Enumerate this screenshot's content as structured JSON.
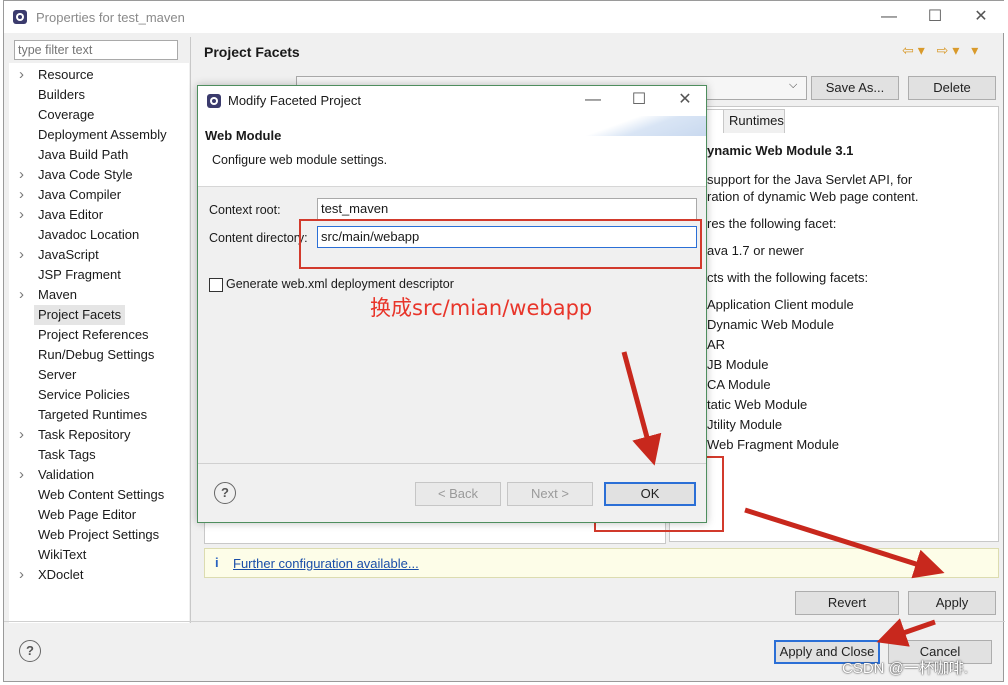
{
  "window": {
    "title": "Properties for test_maven",
    "filter_placeholder": "type filter text"
  },
  "tree": {
    "items": [
      {
        "label": "Resource",
        "expandable": true
      },
      {
        "label": "Builders",
        "expandable": false
      },
      {
        "label": "Coverage",
        "expandable": false
      },
      {
        "label": "Deployment Assembly",
        "expandable": false
      },
      {
        "label": "Java Build Path",
        "expandable": false
      },
      {
        "label": "Java Code Style",
        "expandable": true
      },
      {
        "label": "Java Compiler",
        "expandable": true
      },
      {
        "label": "Java Editor",
        "expandable": true
      },
      {
        "label": "Javadoc Location",
        "expandable": false
      },
      {
        "label": "JavaScript",
        "expandable": true
      },
      {
        "label": "JSP Fragment",
        "expandable": false
      },
      {
        "label": "Maven",
        "expandable": true
      },
      {
        "label": "Project Facets",
        "expandable": false,
        "selected": true
      },
      {
        "label": "Project References",
        "expandable": false
      },
      {
        "label": "Run/Debug Settings",
        "expandable": false
      },
      {
        "label": "Server",
        "expandable": false
      },
      {
        "label": "Service Policies",
        "expandable": false
      },
      {
        "label": "Targeted Runtimes",
        "expandable": false
      },
      {
        "label": "Task Repository",
        "expandable": true
      },
      {
        "label": "Task Tags",
        "expandable": false
      },
      {
        "label": "Validation",
        "expandable": true
      },
      {
        "label": "Web Content Settings",
        "expandable": false
      },
      {
        "label": "Web Page Editor",
        "expandable": false
      },
      {
        "label": "Web Project Settings",
        "expandable": false
      },
      {
        "label": "WikiText",
        "expandable": false
      },
      {
        "label": "XDoclet",
        "expandable": true
      }
    ]
  },
  "right_panel": {
    "title": "Project Facets",
    "save_as_label": "Save As...",
    "delete_label": "Delete",
    "tab_details_fragment": "ls",
    "tab_runtimes": "Runtimes",
    "details_lines": [
      "ynamic Web Module 3.1",
      "support for the Java Servlet API, for",
      "ration of dynamic Web page content.",
      "res the following facet:",
      "ava 1.7 or newer",
      "cts with the following facets:",
      "Application Client module",
      "Dynamic Web Module",
      "AR",
      "JB Module",
      "CA Module",
      "tatic Web Module",
      "Jtility Module",
      "Web Fragment Module"
    ],
    "info_icon_glyph": "i",
    "info_link": "Further configuration available...",
    "revert_label": "Revert",
    "apply_label": "Apply"
  },
  "footer": {
    "apply_close_label": "Apply and Close",
    "cancel_label": "Cancel"
  },
  "dialog": {
    "title": "Modify Faceted Project",
    "header_title": "Web Module",
    "header_desc": "Configure web module settings.",
    "context_root_label": "Context root:",
    "context_root_value": "test_maven",
    "content_dir_label": "Content directory:",
    "content_dir_value": "src/main/webapp",
    "generate_xml_label": "Generate web.xml deployment descriptor",
    "generate_xml_checked": false,
    "back_label": "< Back",
    "next_label": "Next >",
    "ok_label": "OK"
  },
  "annotation": {
    "text": "换成src/mian/webapp",
    "color": "#e8352a"
  },
  "watermark": "CSDN @一杯咖啡."
}
